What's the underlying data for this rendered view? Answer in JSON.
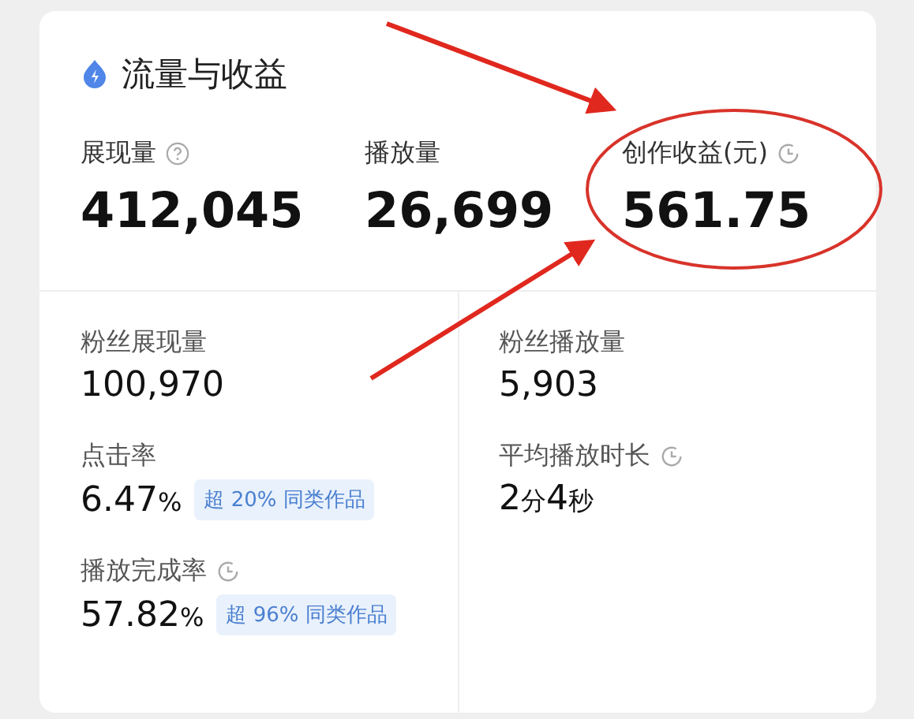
{
  "card": {
    "title": "流量与收益",
    "top_stats": [
      {
        "label": "展现量",
        "kind": "help",
        "value": "412,045"
      },
      {
        "label": "播放量",
        "kind": "plain",
        "value": "26,699"
      },
      {
        "label": "创作收益(元)",
        "kind": "timed",
        "value": "561.75"
      }
    ],
    "columns": [
      [
        {
          "label": "粉丝展现量",
          "kind": "plain",
          "parts": [
            {
              "text": "100,970",
              "kind": "number"
            }
          ]
        },
        {
          "label": "点击率",
          "kind": "plain",
          "parts": [
            {
              "text": "6.47",
              "kind": "number"
            },
            {
              "text": "%",
              "kind": "unit"
            }
          ],
          "badge": "超 20% 同类作品"
        },
        {
          "label": "播放完成率",
          "kind": "timed",
          "parts": [
            {
              "text": "57.82",
              "kind": "number"
            },
            {
              "text": "%",
              "kind": "unit"
            }
          ],
          "badge": "超 96% 同类作品"
        }
      ],
      [
        {
          "label": "粉丝播放量",
          "kind": "plain",
          "parts": [
            {
              "text": "5,903",
              "kind": "number"
            }
          ]
        },
        {
          "label": "平均播放时长",
          "kind": "timed",
          "parts": [
            {
              "text": "2",
              "kind": "number"
            },
            {
              "text": "分",
              "kind": "unit"
            },
            {
              "text": "4",
              "kind": "number"
            },
            {
              "text": "秒",
              "kind": "unit"
            }
          ]
        }
      ]
    ]
  }
}
